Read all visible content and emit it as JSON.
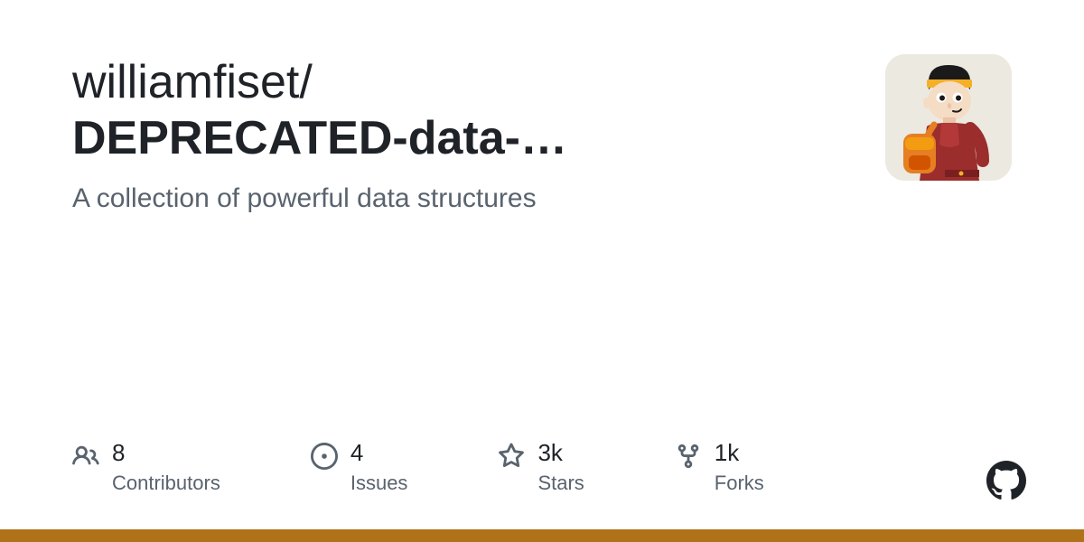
{
  "repo": {
    "owner": "williamfiset",
    "owner_with_slash": "williamfiset/",
    "name_truncated": "DEPRECATED-data-…"
  },
  "description": "A collection of powerful data structures",
  "stats": {
    "contributors": {
      "value": "8",
      "label": "Contributors"
    },
    "issues": {
      "value": "4",
      "label": "Issues"
    },
    "stars": {
      "value": "3k",
      "label": "Stars"
    },
    "forks": {
      "value": "1k",
      "label": "Forks"
    }
  },
  "colors": {
    "language_bar": "#b07219"
  }
}
